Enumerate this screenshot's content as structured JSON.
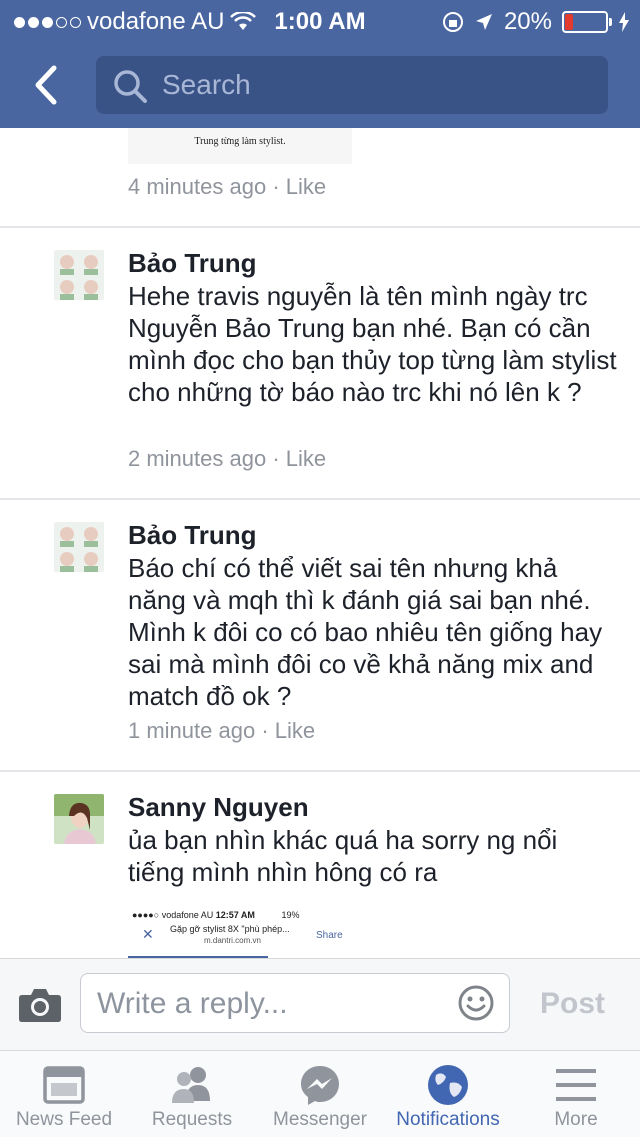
{
  "status_bar": {
    "carrier": "vodafone AU",
    "time": "1:00 AM",
    "battery": "20%"
  },
  "header": {
    "search_placeholder": "Search"
  },
  "thread": {
    "first_item": {
      "image_caption": "Trung từng làm stylist.",
      "time": "4 minutes ago",
      "like": "Like"
    },
    "comments": [
      {
        "author": "Bảo Trung",
        "text": "Hehe travis nguyễn là tên mình ngày trc Nguyễn Bảo Trung bạn nhé. Bạn có cần mình đọc cho bạn thủy top từng làm stylist  cho những tờ báo nào trc khi nó lên k ?",
        "time": "2 minutes ago",
        "like": "Like"
      },
      {
        "author": "Bảo Trung",
        "text": "Báo chí có thể viết sai tên nhưng khả năng và mqh thì k đánh giá sai bạn nhé. Mình k đôi co có bao nhiêu tên giống hay sai mà mình đôi co về khả năng mix and match đồ ok ?",
        "time": "1 minute ago",
        "like": "Like"
      },
      {
        "author": "Sanny Nguyen",
        "text": "ủa bạn nhìn khác quá ha sorry ng nổi tiếng mình nhìn hông có ra",
        "attachment": {
          "carrier": "vodafone AU",
          "time": "12:57 AM",
          "battery": "19%",
          "title": "Gặp gỡ stylist 8X \"phù phép...",
          "domain": "m.dantri.com.vn",
          "share": "Share"
        }
      }
    ]
  },
  "reply": {
    "placeholder": "Write a reply...",
    "post_label": "Post"
  },
  "tabs": [
    {
      "label": "News Feed",
      "icon": "news-feed-icon"
    },
    {
      "label": "Requests",
      "icon": "requests-icon"
    },
    {
      "label": "Messenger",
      "icon": "messenger-icon"
    },
    {
      "label": "Notifications",
      "icon": "globe-icon",
      "active": true
    },
    {
      "label": "More",
      "icon": "menu-icon"
    }
  ],
  "colors": {
    "header": "#4a66a0",
    "accent": "#4267b2",
    "battery_low": "#e23b2d"
  }
}
